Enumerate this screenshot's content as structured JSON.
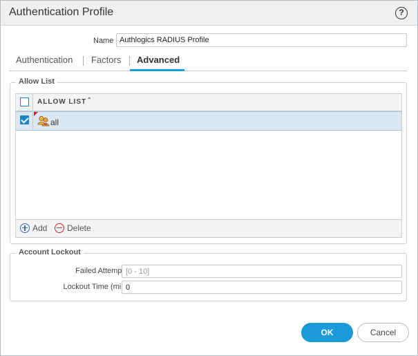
{
  "window": {
    "title": "Authentication Profile"
  },
  "name_field": {
    "label": "Name",
    "value": "Authlogics RADIUS Profile"
  },
  "tabs": [
    {
      "label": "Authentication",
      "active": false
    },
    {
      "label": "Factors",
      "active": false
    },
    {
      "label": "Advanced",
      "active": true
    }
  ],
  "allow_list": {
    "legend": "Allow List",
    "column_header": "ALLOW LIST",
    "rows": [
      {
        "label": "all",
        "checked": true
      }
    ],
    "add_label": "Add",
    "delete_label": "Delete"
  },
  "account_lockout": {
    "legend": "Account Lockout",
    "failed_attempts": {
      "label": "Failed Attempts",
      "placeholder": "[0 - 10]",
      "value": ""
    },
    "lockout_time": {
      "label": "Lockout Time (min)",
      "value": "0"
    }
  },
  "buttons": {
    "ok": "OK",
    "cancel": "Cancel"
  },
  "colors": {
    "accent": "#1a9ad6",
    "selected_row": "#dbe8f2",
    "delete_red": "#c0262d"
  }
}
